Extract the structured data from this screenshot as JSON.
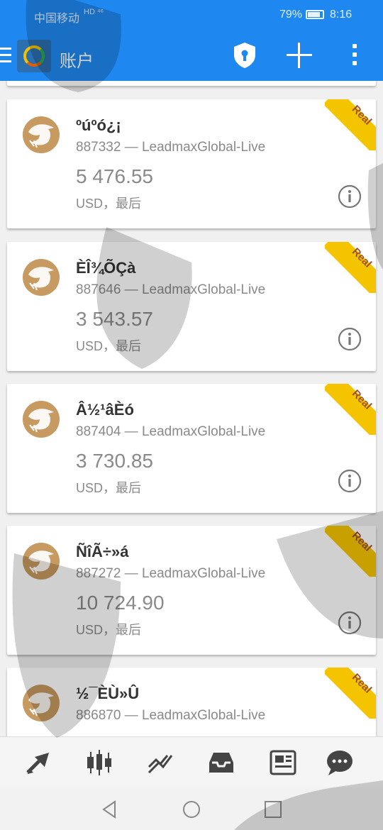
{
  "status_bar": {
    "carrier": "中国移动",
    "signal_text": "HD ⁴⁶",
    "battery_percent": "79%",
    "time": "8:16"
  },
  "app_bar": {
    "title": "账户",
    "icons": [
      "menu-icon",
      "app-logo",
      "shield-lock-icon",
      "plus-icon",
      "more-vert-icon"
    ]
  },
  "accounts": [
    {
      "name": "ºúºó¿¡",
      "login": "887332",
      "separator": " — ",
      "server": "LeadmaxGlobal-Live",
      "balance": "5 476.55",
      "currency_line": "USD，最后",
      "badge": "Real"
    },
    {
      "name": "ÈÎ¾ÕÇà",
      "login": "887646",
      "separator": " — ",
      "server": "LeadmaxGlobal-Live",
      "balance": "3 543.57",
      "currency_line": "USD，最后",
      "badge": "Real"
    },
    {
      "name": "Â½¹âÈó",
      "login": "887404",
      "separator": " — ",
      "server": "LeadmaxGlobal-Live",
      "balance": "3 730.85",
      "currency_line": "USD，最后",
      "badge": "Real"
    },
    {
      "name": "ÑîÃ÷»á",
      "login": "887272",
      "separator": " — ",
      "server": "LeadmaxGlobal-Live",
      "balance": "10 724.90",
      "currency_line": "USD，最后",
      "badge": "Real"
    },
    {
      "name": "½¯ÈÙ»Û",
      "login": "886870",
      "separator": " — ",
      "server": "LeadmaxGlobal-Live",
      "balance": "",
      "currency_line": "",
      "badge": "Real"
    }
  ],
  "bottom_nav": [
    "quotes-icon",
    "chart-candles-icon",
    "trade-icon",
    "inbox-icon",
    "news-icon",
    "chat-icon"
  ],
  "system_nav": [
    "back-icon",
    "home-icon",
    "recents-icon"
  ],
  "colors": {
    "primary": "#1e88f0",
    "badge": "#f5c400",
    "badge_text": "#a0522d",
    "avatar": "#c69a60",
    "muted_text": "#8a8a8a"
  }
}
